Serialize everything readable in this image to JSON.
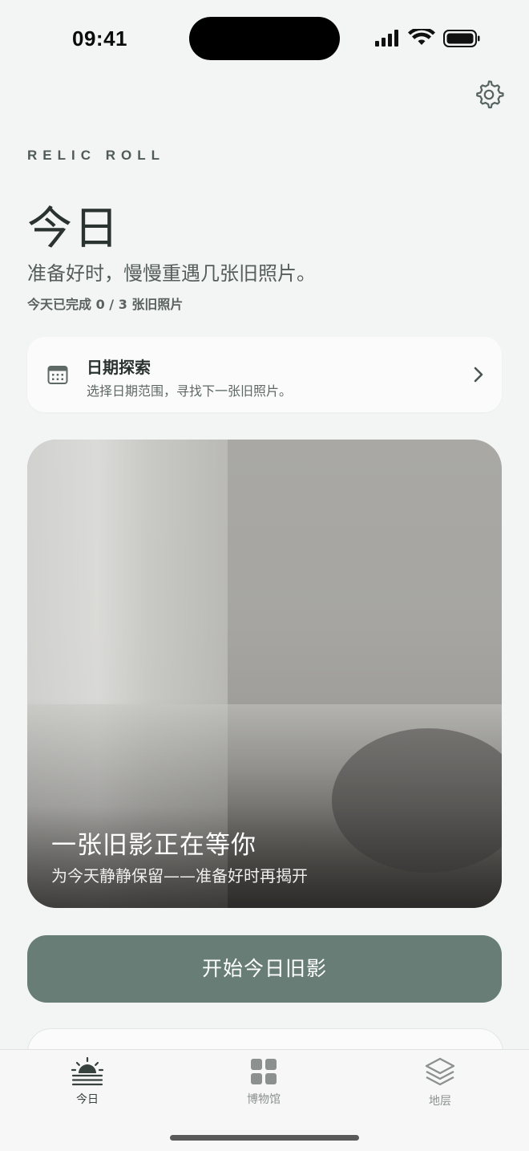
{
  "status": {
    "time": "09:41"
  },
  "brand": "RELIC ROLL",
  "header": {
    "title": "今日",
    "subtitle": "准备好时，慢慢重遇几张旧照片。",
    "progress": "今天已完成 0 / 3 张旧照片"
  },
  "date_explore": {
    "title": "日期探索",
    "description": "选择日期范围，寻找下一张旧照片。"
  },
  "featured": {
    "headline": "一张旧影正在等你",
    "caption": "为今天静静保留——准备好时再揭开"
  },
  "start_button": "开始今日旧影",
  "tabs": [
    {
      "label": "今日",
      "icon": "sunrise-icon",
      "active": true
    },
    {
      "label": "博物馆",
      "icon": "grid-icon",
      "active": false
    },
    {
      "label": "地层",
      "icon": "layers-icon",
      "active": false
    }
  ],
  "colors": {
    "accent": "#677d75",
    "background": "#f3f5f4",
    "active_tab": "#37413e",
    "inactive_tab": "#8c918f"
  }
}
